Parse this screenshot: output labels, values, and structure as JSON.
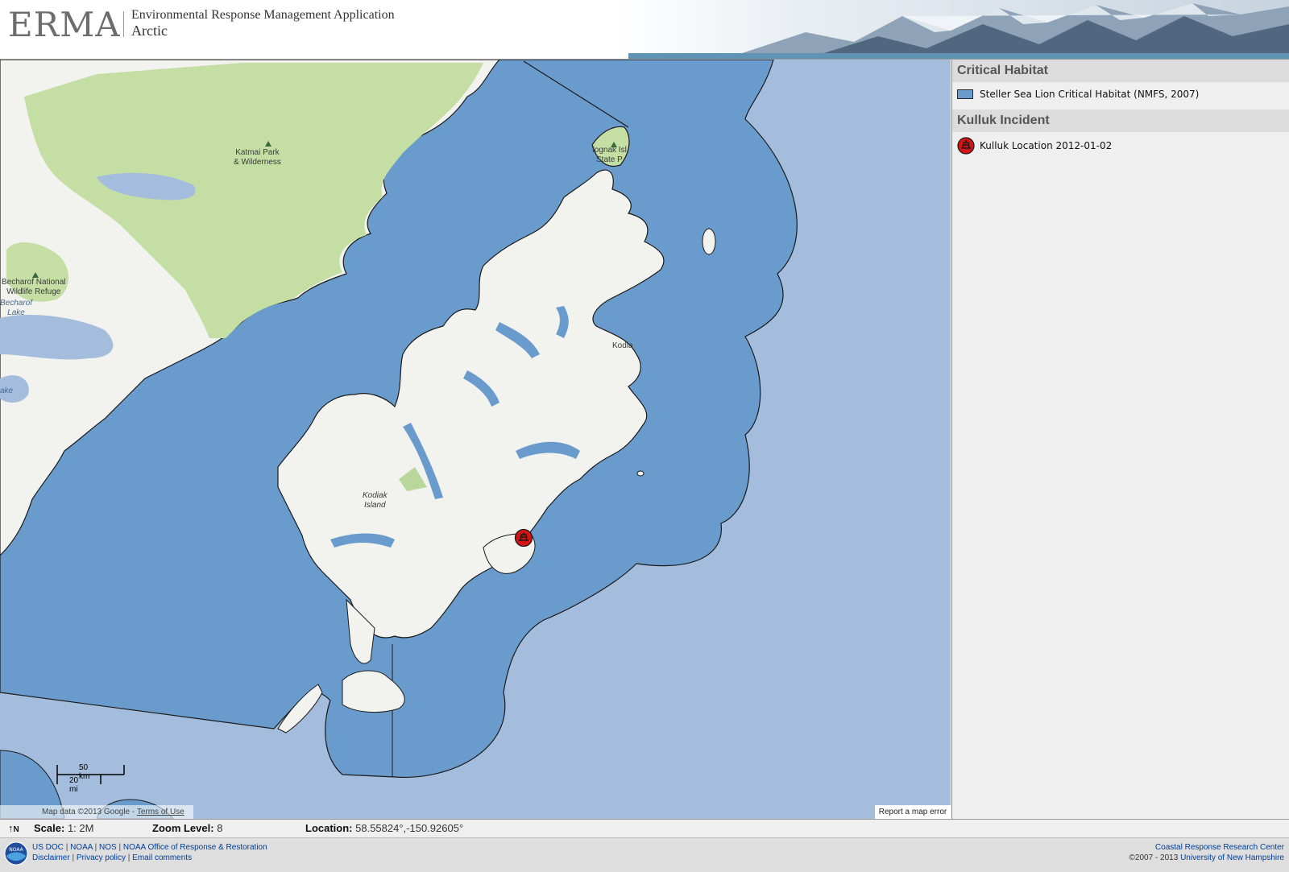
{
  "header": {
    "logo_text": "ERMA",
    "app_title": "Environmental Response Management Application",
    "app_subtitle": "Arctic"
  },
  "map": {
    "labels": {
      "katmai": "Katmai Park",
      "katmai2": "& Wilderness",
      "becharof": "Becharof National",
      "becharof2": "Wildlife Refuge",
      "becharof_lake": "Becharof",
      "becharof_lake2": "Lake",
      "lake_partial": "ake",
      "afognak": "fognak Isl",
      "afognak2": "State P",
      "kodiak_city": "Kodia",
      "kodiak_island": "Kodiak",
      "kodiak_island2": "Island"
    },
    "scale": {
      "km": "50 km",
      "mi": "20 mi"
    },
    "attribution_prefix": "Map data ©2013 Google - ",
    "terms_link": "Terms of Use",
    "report_error": "Report a map error",
    "colors": {
      "water": "#a4bddd",
      "habitat": "#6a9bcd",
      "land": "#f2f2ee",
      "park": "#c5dea4"
    }
  },
  "legend": {
    "sections": [
      {
        "title": "Critical Habitat",
        "item": "Steller Sea Lion Critical Habitat (NMFS, 2007)"
      },
      {
        "title": "Kulluk Incident",
        "item": "Kulluk Location 2012-01-02"
      }
    ]
  },
  "status": {
    "north": "N",
    "scale_label": "Scale:",
    "scale_value": "1: 2M",
    "zoom_label": "Zoom Level:",
    "zoom_value": "8",
    "location_label": "Location:",
    "location_value": "58.55824°,-150.92605°"
  },
  "footer": {
    "links_row1": [
      "US DOC",
      "NOAA",
      "NOS",
      "NOAA Office of Response & Restoration"
    ],
    "links_row2": [
      "Disclaimer",
      "Privacy policy",
      "Email comments"
    ],
    "right_line1": "Coastal Response Research Center",
    "right_line2_prefix": "©2007 - 2013 ",
    "right_line2_link": "University of New Hampshire",
    "logo_text": "NOAA"
  }
}
